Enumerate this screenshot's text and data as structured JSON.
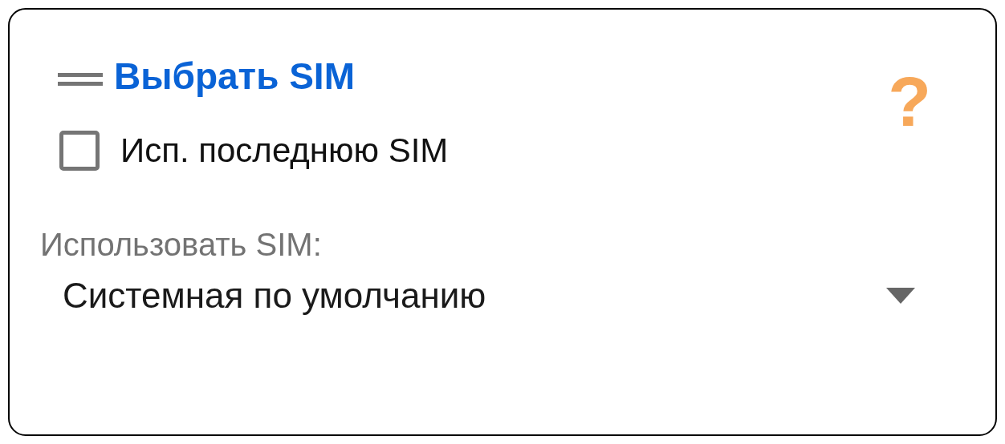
{
  "header": {
    "title": "Выбрать SIM",
    "help_glyph": "?"
  },
  "checkbox": {
    "label": "Исп. последнюю SIM",
    "checked": false
  },
  "dropdown": {
    "label": "Использовать SIM:",
    "value": "Системная по умолчанию"
  }
}
